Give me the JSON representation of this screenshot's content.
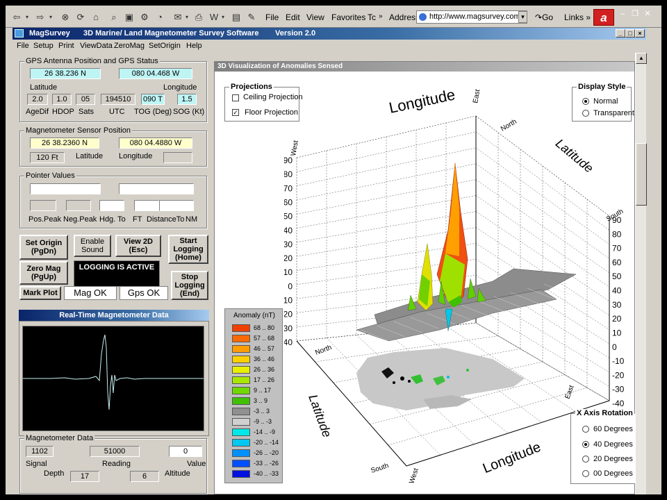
{
  "browser": {
    "menus": [
      "File",
      "Edit",
      "View",
      "Favorites",
      "Tc"
    ],
    "address_label": "Address",
    "url": "http://www.magsurvey.com/",
    "go_label": "Go",
    "links_label": "Links"
  },
  "app": {
    "title": "MagSurvey",
    "subtitle": "3D Marine/ Land Magnetometer Survey Software",
    "version": "Version 2.0",
    "menu": [
      "File",
      "Setup",
      "Print",
      "ViewData",
      "ZeroMag",
      "SetOrigin",
      "Help"
    ]
  },
  "gps": {
    "group_title": "GPS Antenna Position and GPS Status",
    "latitude_value": "26 38.236 N",
    "longitude_value": "080 04.468 W",
    "latitude_label": "Latitude",
    "longitude_label": "Longitude",
    "agedif": "2.0",
    "hdop": "1.0",
    "sats": "05",
    "utc": "194510",
    "tog": "090 T",
    "sog": "1.5",
    "agedif_label": "AgeDif",
    "hdop_label": "HDOP",
    "sats_label": "Sats",
    "utc_label": "UTC",
    "tog_label": "TOG (Deg)",
    "sog_label": "SOG (Kt)"
  },
  "sensor": {
    "group_title": "Magnetometer Sensor Position",
    "latitude_value": "26 38.2360 N",
    "longitude_value": "080 04.4880 W",
    "depth_value": "120 Ft",
    "latitude_label": "Latitude",
    "longitude_label": "Longitude"
  },
  "pointer": {
    "group_title": "Pointer Values",
    "labels": [
      "Pos.Peak",
      "Neg.Peak",
      "Hdg. To",
      "FT",
      "DistanceTo",
      "NM"
    ]
  },
  "buttons": {
    "set_origin": "Set Origin (PgDn)",
    "enable_sound": "Enable Sound",
    "view_2d": "View 2D (Esc)",
    "start_logging": "Start Logging (Home)",
    "zero_mag": "Zero Mag (PgUp)",
    "logging_status": "LOGGING IS  ACTIVE",
    "stop_logging": "Stop Logging (End)",
    "mark_plot": "Mark Plot",
    "mag_ok": "Mag OK",
    "gps_ok": "Gps OK"
  },
  "realtime": {
    "title": "Real-Time Magnetometer Data"
  },
  "magdata": {
    "group_title": "Magnetometer Data",
    "signal_value": "1102",
    "reading_value": "51000",
    "value_value": "0",
    "signal_label": "Signal",
    "reading_label": "Reading",
    "value_label": "Value",
    "depth_label": "Depth",
    "depth_value": "17",
    "altitude_value": "6",
    "altitude_label": "Altitude"
  },
  "viz": {
    "title": "3D Visualization of Anomalies Sensed",
    "projections": {
      "title": "Projections",
      "ceiling": "Ceiling Projection",
      "floor": "Floor Projection",
      "ceiling_checked": false,
      "floor_checked": true
    },
    "display_style": {
      "title": "Display Style",
      "options": [
        "Normal",
        "Transparent"
      ],
      "selected": "Normal"
    },
    "rotation": {
      "title": "X Axis Rotation",
      "options": [
        "60 Degrees",
        "40 Degrees",
        "20 Degrees",
        "00 Degrees"
      ],
      "selected": "40 Degrees"
    },
    "legend": {
      "title": "Anomaly (nT)",
      "items": [
        {
          "range": "68 .. 80",
          "color": "#f04000"
        },
        {
          "range": "57 .. 68",
          "color": "#ff6a00"
        },
        {
          "range": "46 .. 57",
          "color": "#ff9c00"
        },
        {
          "range": "36 .. 46",
          "color": "#ffd000"
        },
        {
          "range": "26 .. 36",
          "color": "#e8f000"
        },
        {
          "range": "17 .. 26",
          "color": "#a8e800"
        },
        {
          "range": "9 .. 17",
          "color": "#70d800"
        },
        {
          "range": "3 .. 9",
          "color": "#40c000"
        },
        {
          "range": "-3 .. 3",
          "color": "#909090"
        },
        {
          "range": "-9 .. -3",
          "color": "#d0d0d0"
        },
        {
          "range": "-14 .. -9",
          "color": "#00e8e8"
        },
        {
          "range": "-20 .. -14",
          "color": "#00c8f0"
        },
        {
          "range": "-26 .. -20",
          "color": "#0090ff"
        },
        {
          "range": "-33 .. -26",
          "color": "#0050ff"
        },
        {
          "range": "-40 .. -33",
          "color": "#0010e0"
        }
      ]
    },
    "axes": {
      "longitude_top": "Longitude",
      "latitude_right": "Latitude",
      "latitude_left": "Latitude",
      "longitude_bottom": "Longitude",
      "east_top": "East",
      "west_left": "West",
      "north_top": "North",
      "south_right": "South",
      "north_left": "North",
      "east_right": "East",
      "south_bottom": "South",
      "west_bottom": "West",
      "z_ticks_left": [
        "90",
        "80",
        "70",
        "60",
        "50",
        "40",
        "30",
        "20",
        "10",
        "0",
        "-10",
        "-20",
        "-30",
        "-40"
      ],
      "z_ticks_right": [
        "90",
        "80",
        "70",
        "60",
        "50",
        "40",
        "30",
        "20",
        "10",
        "0",
        "-10",
        "-20",
        "-30",
        "-40"
      ]
    },
    "peaks": [
      {
        "name": "peak-main",
        "value": 80
      },
      {
        "name": "peak-secondary",
        "value": 60
      }
    ]
  }
}
